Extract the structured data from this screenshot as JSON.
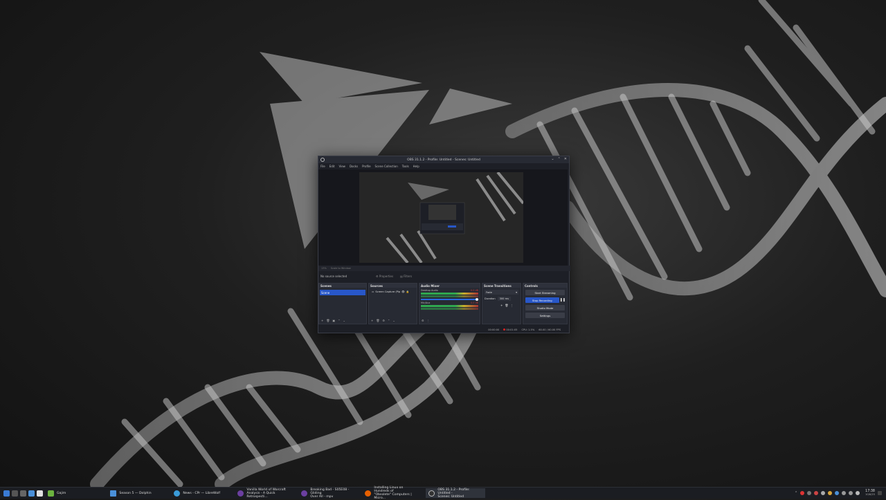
{
  "obs": {
    "title": "OBS 31.1.2 - Profile: Untitled - Scenes: Untitled",
    "menu": [
      "File",
      "Edit",
      "View",
      "Docks",
      "Profile",
      "Scene Collection",
      "Tools",
      "Help"
    ],
    "toolbar": [
      "13%",
      "Scale to Window"
    ],
    "no_source": "No source selected",
    "properties_btn": "Properties",
    "filters_btn": "Filters",
    "docks": {
      "scenes": {
        "title": "Scenes",
        "items": [
          "Scene"
        ]
      },
      "sources": {
        "title": "Sources",
        "items": [
          "Screen Capture (Pip"
        ]
      },
      "mixer": {
        "title": "Audio Mixer",
        "channels": [
          {
            "name": "Desktop Audio",
            "db": "0.0 dB"
          },
          {
            "name": "Mic/Aux",
            "db": "0.0 dB"
          }
        ]
      },
      "transitions": {
        "title": "Scene Transitions",
        "selected": "Fade",
        "duration_label": "Duration",
        "duration_value": "300 ms"
      },
      "controls": {
        "title": "Controls",
        "buttons": [
          "Start Streaming",
          "Stop Recording",
          "Studio Mode",
          "Settings"
        ]
      }
    },
    "status": {
      "stream_time": "00:00:00",
      "rec_time": "00:01:05",
      "cpu": "CPU: 1.5%",
      "fps": "60.00 / 60.00 FPS"
    }
  },
  "taskbar": {
    "launcher": "Gajim",
    "tasks": [
      {
        "label": "Season 5 — Dolphin",
        "active": false
      },
      {
        "label": "News - CPr — LibreWolf",
        "active": false
      },
      {
        "label": "Vanilla World of Warcraft\nAnalysis - A Quick Retrospecti...",
        "active": false
      },
      {
        "label": "Breaking Bad - S05E08 - Gliding\nOver All - mpv",
        "active": false
      },
      {
        "label": "Installing Linux on Hundreds of\n\"Obsolete\" Computers | Micro...",
        "active": false
      },
      {
        "label": "OBS 31.1.2 - Profile: Untitled -\nScenes: Untitled",
        "active": true
      }
    ],
    "clock": {
      "time": "17:38",
      "date": "10/6/25"
    }
  },
  "colors": {
    "accent": "#2857c9",
    "record": "#d22"
  }
}
